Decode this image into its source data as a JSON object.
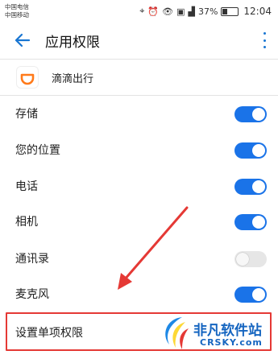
{
  "status": {
    "carrier1": "中国电信",
    "carrier2": "中国移动",
    "battery": "37%",
    "time": "12:04"
  },
  "appbar": {
    "title": "应用权限"
  },
  "app": {
    "name": "滴滴出行"
  },
  "permissions": [
    {
      "label": "存储",
      "on": true
    },
    {
      "label": "您的位置",
      "on": true
    },
    {
      "label": "电话",
      "on": true
    },
    {
      "label": "相机",
      "on": true
    },
    {
      "label": "通讯录",
      "on": false
    },
    {
      "label": "麦克风",
      "on": true
    }
  ],
  "single": {
    "label": "设置单项权限"
  },
  "watermark": {
    "text": "非凡软件站",
    "sub": "CRSKY.com"
  },
  "colors": {
    "accent": "#1a73e8",
    "annotation": "#e53935",
    "toggle_off": "#e6e6e6",
    "didi": "#ff7a1a"
  }
}
